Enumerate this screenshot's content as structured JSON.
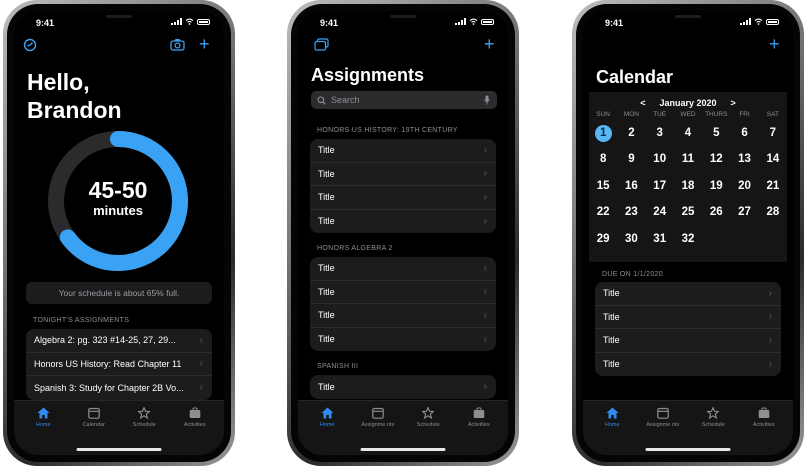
{
  "status_time": "9:41",
  "home": {
    "greeting_line1": "Hello,",
    "greeting_line2": "Brandon",
    "ring_value": "45-50",
    "ring_unit": "minutes",
    "ring_fraction": 0.65,
    "ring_color": "#3aa2f5",
    "schedule_note": "Your schedule is about 65% full.",
    "section_header": "TONIGHT'S ASSIGNMENTS",
    "assignments": [
      "Algebra 2: pg. 323 #14-25, 27, 29...",
      "Honors US History: Read Chapter 11",
      "Spanish 3: Study for Chapter 2B Vo..."
    ]
  },
  "assignments_screen": {
    "title": "Assignments",
    "search_placeholder": "Search",
    "sections": [
      {
        "header": "HONORS US HISTORY: 19TH CENTURY",
        "rows": [
          "Title",
          "Title",
          "Title",
          "Title"
        ]
      },
      {
        "header": "HONORS ALGEBRA 2",
        "rows": [
          "Title",
          "Title",
          "Title",
          "Title"
        ]
      },
      {
        "header": "SPANISH III",
        "rows": [
          "Title"
        ]
      }
    ]
  },
  "calendar_screen": {
    "title": "Calendar",
    "prev": "<",
    "month": "January 2020",
    "next": ">",
    "weekdays": [
      "SUN",
      "MON",
      "TUE",
      "WED",
      "THURS",
      "FRI",
      "SAT"
    ],
    "days": [
      [
        "1",
        "2",
        "3",
        "4",
        "5",
        "6",
        "7"
      ],
      [
        "8",
        "9",
        "10",
        "11",
        "12",
        "13",
        "14"
      ],
      [
        "15",
        "16",
        "17",
        "18",
        "19",
        "20",
        "21"
      ],
      [
        "22",
        "23",
        "24",
        "25",
        "26",
        "27",
        "28"
      ],
      [
        "29",
        "30",
        "31",
        "32"
      ]
    ],
    "selected_day": "1",
    "due_header": "DUE ON 1/1/2020",
    "due_rows": [
      "Title",
      "Title",
      "Title",
      "Title"
    ]
  },
  "tabbar": {
    "home": "Home",
    "calendar": "Calendar",
    "schedule": "Schedule",
    "activities": "Activities",
    "assignments": "Assignme nts",
    "active_color": "#2f8bf0"
  },
  "icons": {
    "home_left": "clock-icon",
    "home_camera": "camera-icon",
    "plus": "plus-icon",
    "assignments_left": "cards-icon",
    "search": "search-icon",
    "mic": "mic-icon"
  }
}
